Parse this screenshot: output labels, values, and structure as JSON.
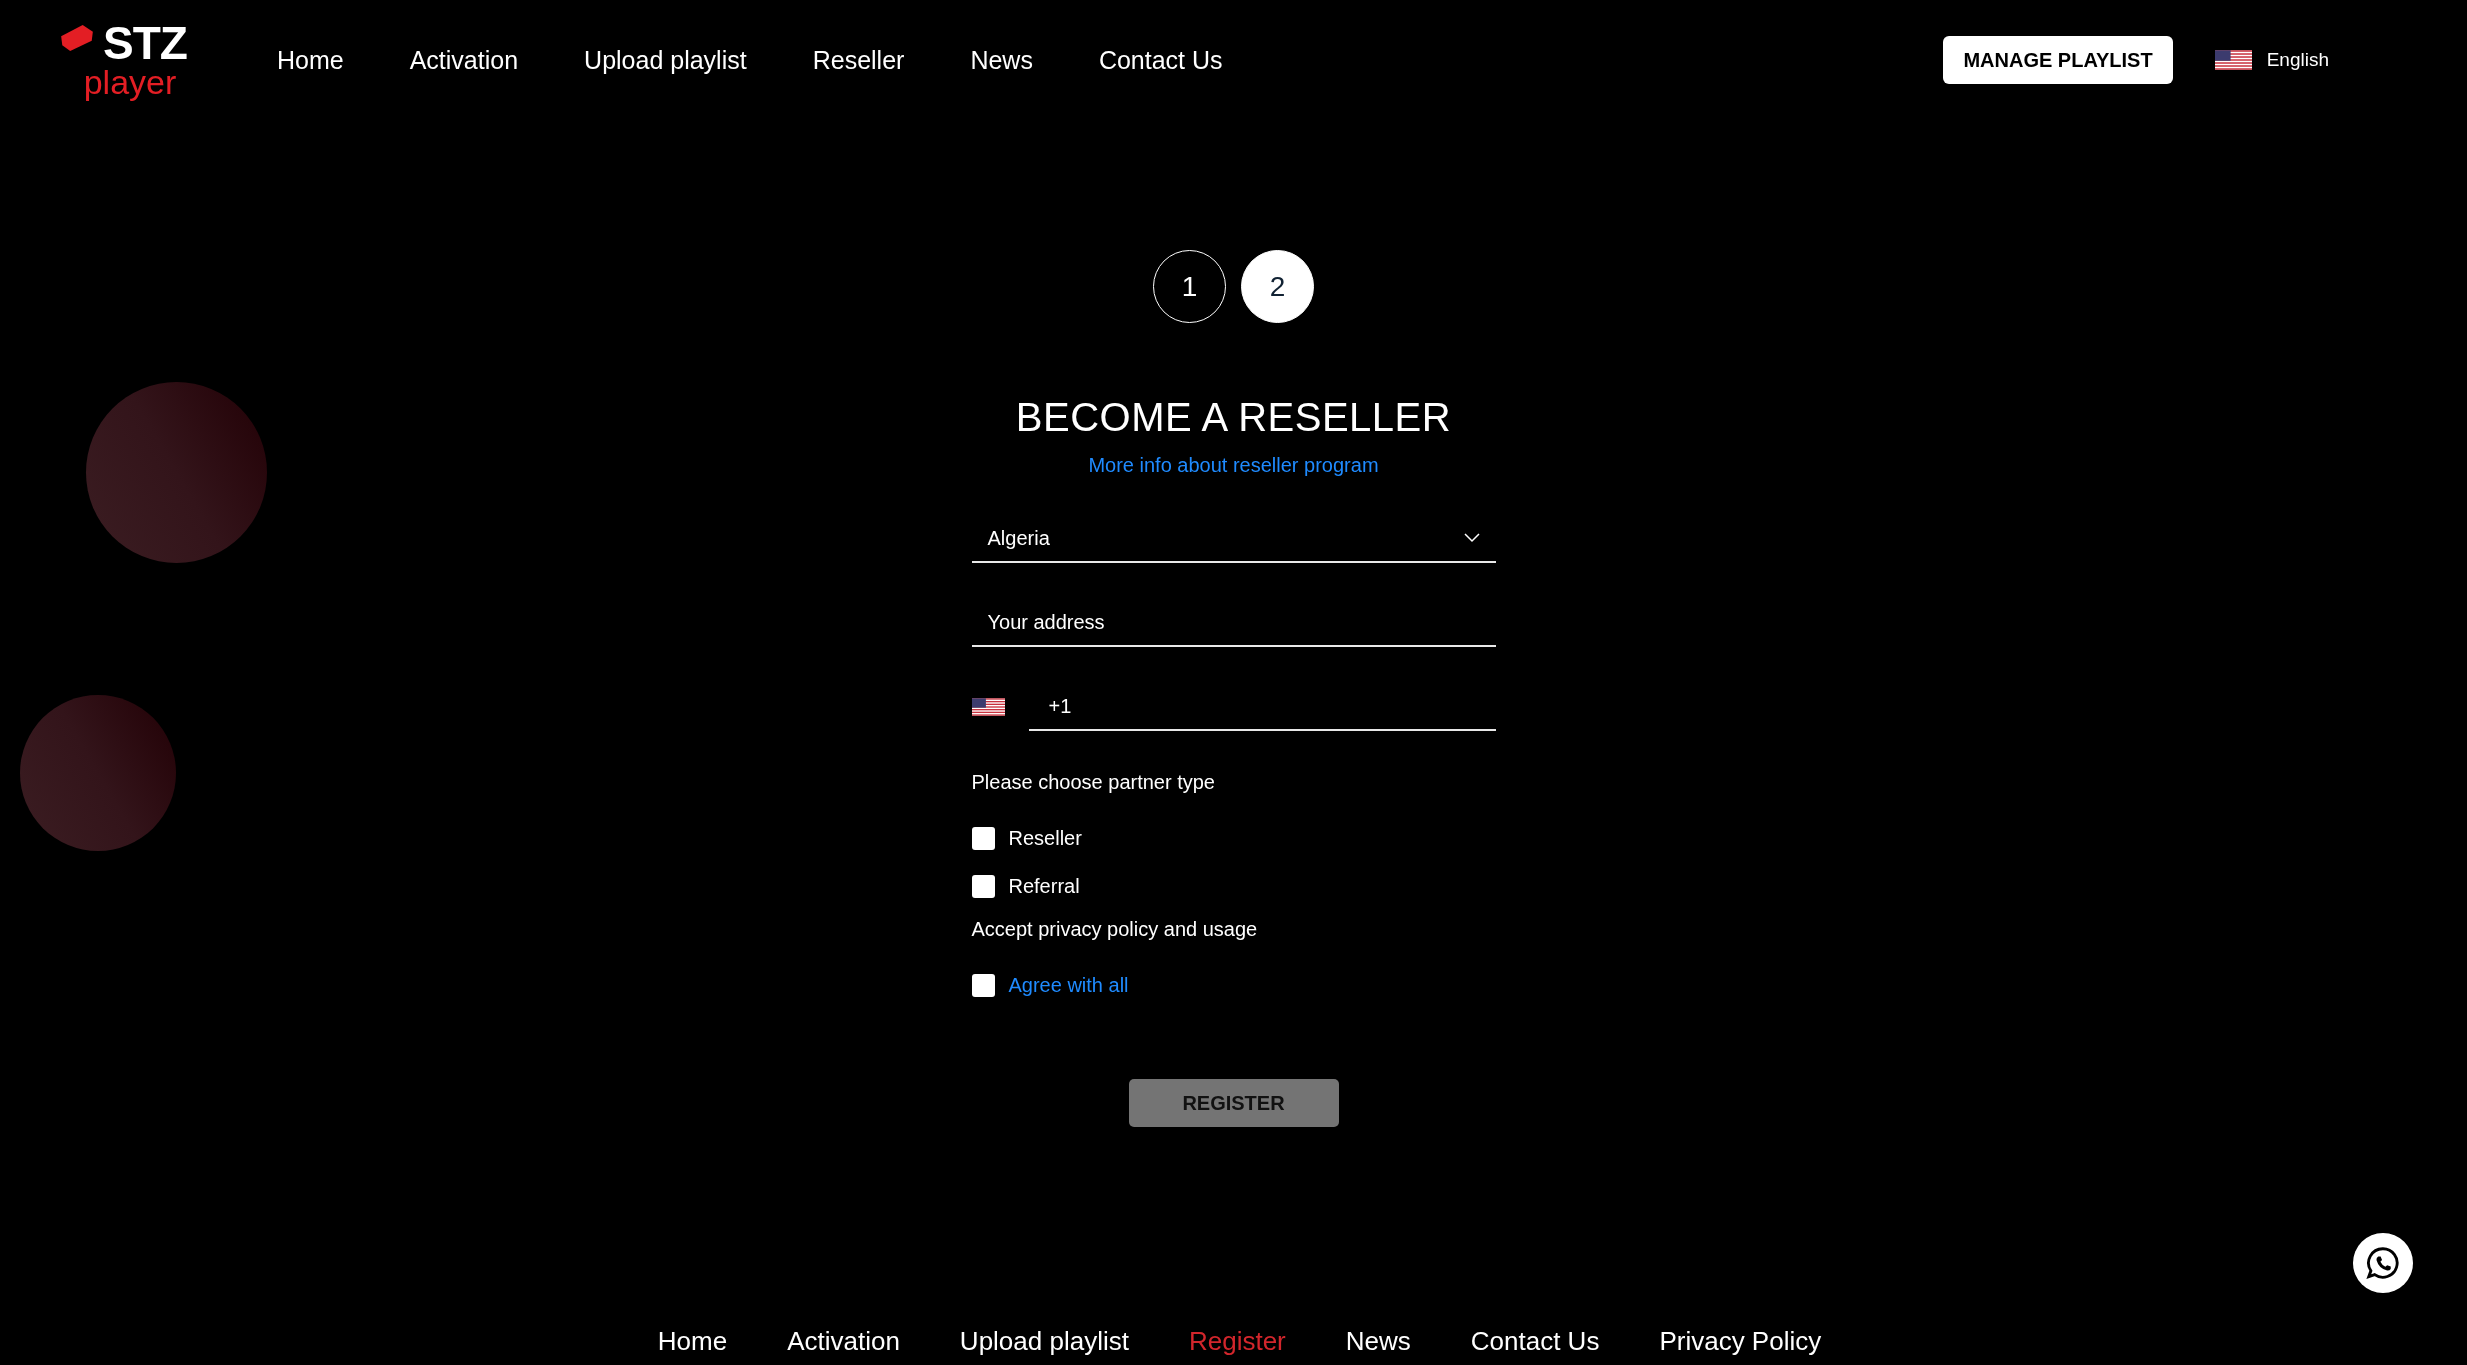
{
  "header": {
    "logo": {
      "brand": "STZ",
      "sub": "player"
    },
    "nav": [
      {
        "label": "Home"
      },
      {
        "label": "Activation"
      },
      {
        "label": "Upload playlist"
      },
      {
        "label": "Reseller"
      },
      {
        "label": "News"
      },
      {
        "label": "Contact Us"
      }
    ],
    "manage_button": "MANAGE PLAYLIST",
    "language": "English"
  },
  "steps": [
    {
      "label": "1",
      "selected": false
    },
    {
      "label": "2",
      "selected": true
    }
  ],
  "title": "BECOME A RESELLER",
  "info_link": "More info about reseller program",
  "form": {
    "country": {
      "value": "Algeria"
    },
    "address": {
      "placeholder": "Your address"
    },
    "phone": {
      "value": "+1"
    },
    "partner_label": "Please choose partner type",
    "partner_types": [
      {
        "label": "Reseller",
        "checked": false
      },
      {
        "label": "Referral",
        "checked": false
      }
    ],
    "privacy_label": "Accept privacy policy and usage",
    "agree": {
      "label": "Agree with all",
      "checked": false
    },
    "register_button": {
      "label": "REGISTER",
      "disabled": true
    }
  },
  "footer": {
    "nav": [
      {
        "label": "Home",
        "selected": false
      },
      {
        "label": "Activation",
        "selected": false
      },
      {
        "label": "Upload playlist",
        "selected": false
      },
      {
        "label": "Register",
        "selected": true
      },
      {
        "label": "News",
        "selected": false
      },
      {
        "label": "Contact Us",
        "selected": false
      },
      {
        "label": "Privacy Policy",
        "selected": false
      }
    ]
  }
}
